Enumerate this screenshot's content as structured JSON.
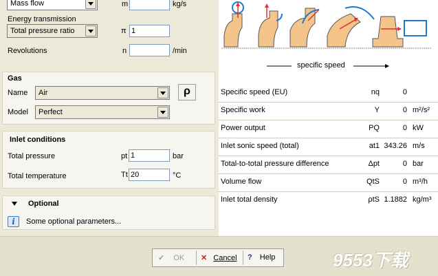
{
  "flow": {
    "mode_value": "Mass flow",
    "symbol": "m",
    "value": "",
    "unit": "kg/s"
  },
  "energy": {
    "label": "Energy transmission",
    "mode_value": "Total pressure ratio",
    "symbol": "π",
    "value": "1"
  },
  "revolutions": {
    "label": "Revolutions",
    "symbol": "n",
    "value": "",
    "unit": "/min"
  },
  "gas": {
    "title": "Gas",
    "name_label": "Name",
    "name_value": "Air",
    "rho_label": "ρ",
    "model_label": "Model",
    "model_value": "Perfect"
  },
  "inlet": {
    "title": "Inlet conditions",
    "pressure_label": "Total pressure",
    "pressure_symbol": "pt",
    "pressure_value": "1",
    "pressure_unit": "bar",
    "temperature_label": "Total temperature",
    "temperature_symbol": "Tt",
    "temperature_value": "20",
    "temperature_unit": "°C"
  },
  "optional": {
    "title": "Optional",
    "info_text": "Some optional parameters..."
  },
  "diagram": {
    "axis_label": "specific speed"
  },
  "results": [
    {
      "name": "Specific speed (EU)",
      "symbol": "nq",
      "value": "0",
      "unit": ""
    },
    {
      "name": "Specific work",
      "symbol": "Y",
      "value": "0",
      "unit": "m²/s²"
    },
    {
      "name": "Power output",
      "symbol": "PQ",
      "value": "0",
      "unit": "kW"
    },
    {
      "name": "Inlet sonic speed (total)",
      "symbol": "at1",
      "value": "343.26",
      "unit": "m/s"
    },
    {
      "name": "Total-to-total pressure difference",
      "symbol": "Δpt",
      "value": "0",
      "unit": "bar"
    },
    {
      "name": "Volume flow",
      "symbol": "QtS",
      "value": "0",
      "unit": "m³/h"
    },
    {
      "name": "Inlet total density",
      "symbol": "ρtS",
      "value": "1.1882",
      "unit": "kg/m³"
    }
  ],
  "buttons": {
    "ok": "OK",
    "cancel": "Cancel",
    "help": "Help"
  },
  "watermark": "9553下载",
  "colors": {
    "accent_blue": "#1e78d2",
    "arrow_red": "#e03030",
    "impeller_fill": "#f4c48a"
  }
}
